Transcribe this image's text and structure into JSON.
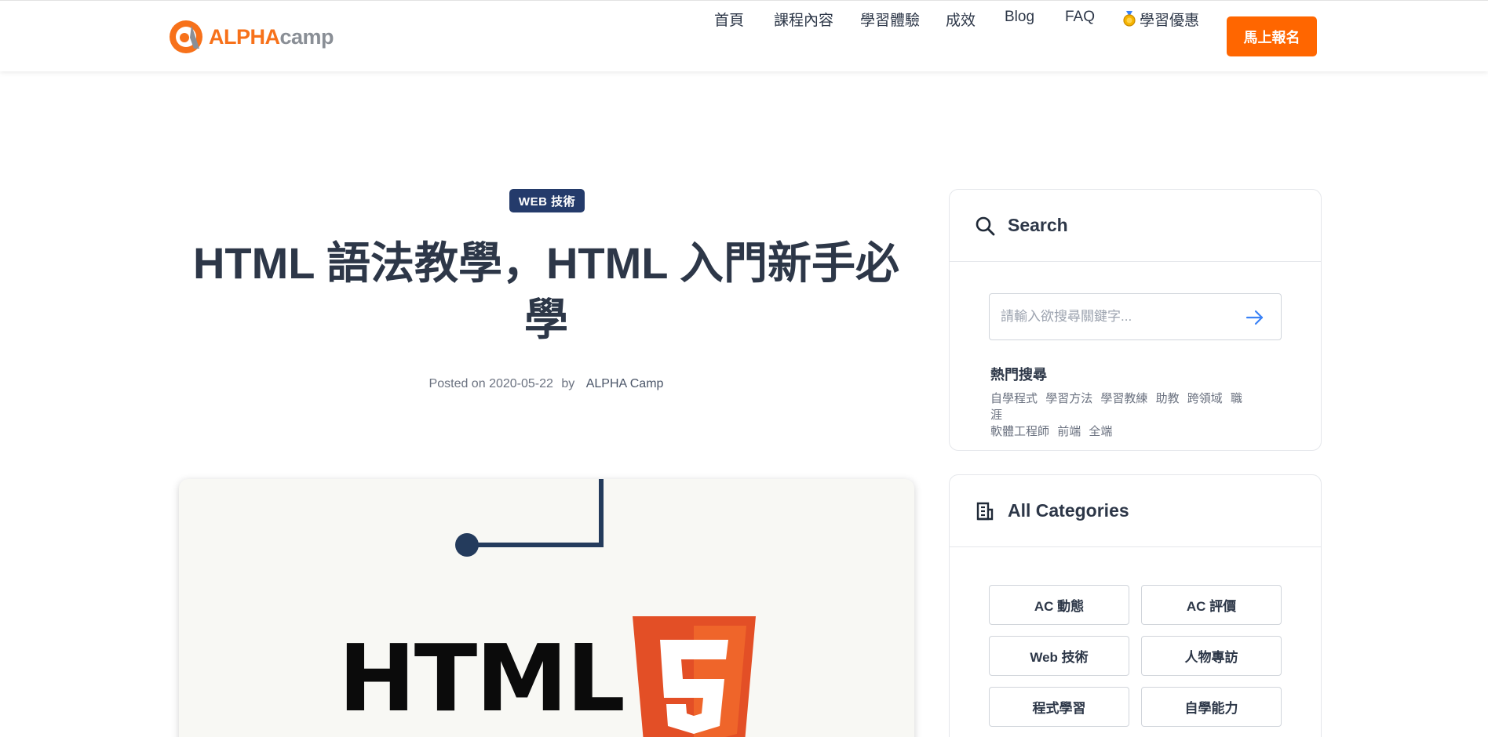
{
  "header": {
    "logo": {
      "alpha": "ALPHA",
      "camp": "camp",
      "accent": "#f7711a"
    },
    "nav": [
      {
        "label": "首頁"
      },
      {
        "label": "課程內容"
      },
      {
        "label": "學習體驗"
      },
      {
        "label": "成效"
      },
      {
        "label": "Blog"
      },
      {
        "label": "FAQ"
      },
      {
        "label": "學習優惠",
        "icon": "medal-icon"
      }
    ],
    "cta_label": "馬上報名",
    "cta_color": "#ff6600"
  },
  "article": {
    "category": "WEB 技術",
    "title": "HTML 語法教學，HTML 入門新手必學",
    "posted_prefix": "Posted on",
    "date": "2020-05-22",
    "by": "by",
    "author": "ALPHA Camp",
    "feature_image": {
      "word": "HTML",
      "badge": "5"
    }
  },
  "sidebar": {
    "search": {
      "title": "Search",
      "placeholder": "請輸入欲搜尋關鍵字...",
      "hot_title": "熱門搜尋",
      "hot_tags": [
        "自學程式",
        "學習方法",
        "學習教練",
        "助教",
        "跨領域",
        "職涯",
        "軟體工程師",
        "前端",
        "全端"
      ]
    },
    "categories": {
      "title": "All Categories",
      "items": [
        "AC 動態",
        "AC 評價",
        "Web 技術",
        "人物專訪",
        "程式學習",
        "自學能力"
      ]
    }
  }
}
